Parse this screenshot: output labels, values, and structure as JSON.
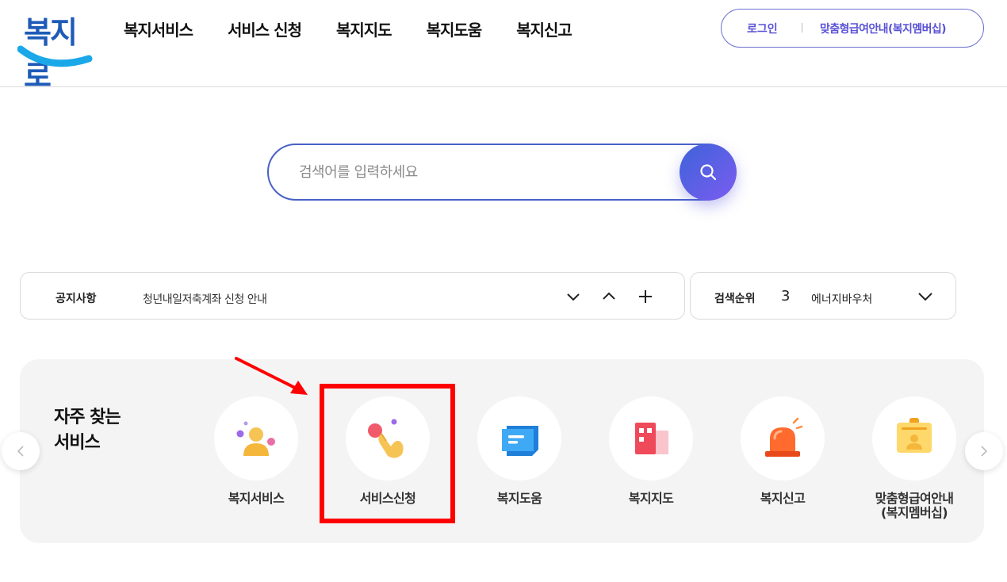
{
  "header": {
    "logo_text": "복지로",
    "nav": [
      "복지서비스",
      "서비스 신청",
      "복지지도",
      "복지도움",
      "복지신고"
    ],
    "login_label": "로그인",
    "member_label": "맞춤형급여안내(복지멤버십)"
  },
  "search": {
    "placeholder": "검색어를 입력하세요",
    "icon": "search-icon"
  },
  "notice": {
    "label": "공지사항",
    "text": "청년내일저축계좌 신청 안내",
    "controls": [
      "chevron-down-icon",
      "chevron-up-icon",
      "plus-icon"
    ]
  },
  "ranking": {
    "label": "검색순위",
    "rank": "3",
    "keyword": "에너지바우처"
  },
  "frequent": {
    "title_line1": "자주 찾는",
    "title_line2": "서비스",
    "items": [
      {
        "label": "복지서비스",
        "icon": "person-icon"
      },
      {
        "label": "서비스신청",
        "icon": "hand-pointer-icon"
      },
      {
        "label": "복지도움",
        "icon": "chat-bubble-icon"
      },
      {
        "label": "복지지도",
        "icon": "map-building-icon"
      },
      {
        "label": "복지신고",
        "icon": "siren-icon"
      },
      {
        "label_line1": "맞춤형급여안내",
        "label_line2": "(복지멤버십)",
        "icon": "membership-card-icon"
      }
    ]
  },
  "colors": {
    "brand": "#1e5bb8",
    "accent": "#5a52d6",
    "search_border": "#4862c8",
    "highlight": "#ff0000"
  }
}
